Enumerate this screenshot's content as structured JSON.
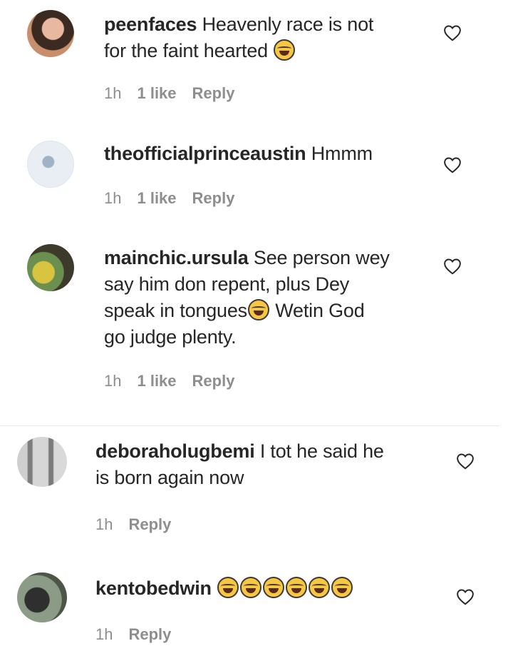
{
  "comments": [
    {
      "username": "peenfaces",
      "text_line1": " Heavenly race is not",
      "text_line2": "for the faint hearted ",
      "time": "1h",
      "likes": "1 like",
      "reply": "Reply",
      "emoji": [
        "face-with-tears-of-joy-emoji"
      ]
    },
    {
      "username": "theofficialprinceaustin",
      "text_line1": " Hmmm",
      "time": "1h",
      "likes": "1 like",
      "reply": "Reply"
    },
    {
      "username": "mainchic.ursula",
      "text_line1": " See person wey",
      "text_line2": "say him don repent, plus Dey",
      "text_line3a": "speak in tongues",
      "text_line3b": " Wetin God",
      "text_line4": "go judge plenty.",
      "time": "1h",
      "likes": "1 like",
      "reply": "Reply",
      "emoji": [
        "face-with-tears-of-joy-emoji"
      ]
    },
    {
      "username": "deboraholugbemi",
      "text_line1": " I tot he said he",
      "text_line2": "is born again now",
      "time": "1h",
      "reply": "Reply"
    },
    {
      "username": "kentobedwin",
      "time": "1h",
      "reply": "Reply",
      "emoji": [
        "face-with-tears-of-joy-emoji",
        "face-with-tears-of-joy-emoji",
        "face-with-tears-of-joy-emoji",
        "face-with-tears-of-joy-emoji",
        "face-with-tears-of-joy-emoji",
        "face-with-tears-of-joy-emoji"
      ]
    }
  ],
  "icons": {
    "heart": "heart-outline-icon"
  },
  "colors": {
    "text": "#262626",
    "meta": "#8e8e8e",
    "divider": "#e6e6e6"
  }
}
